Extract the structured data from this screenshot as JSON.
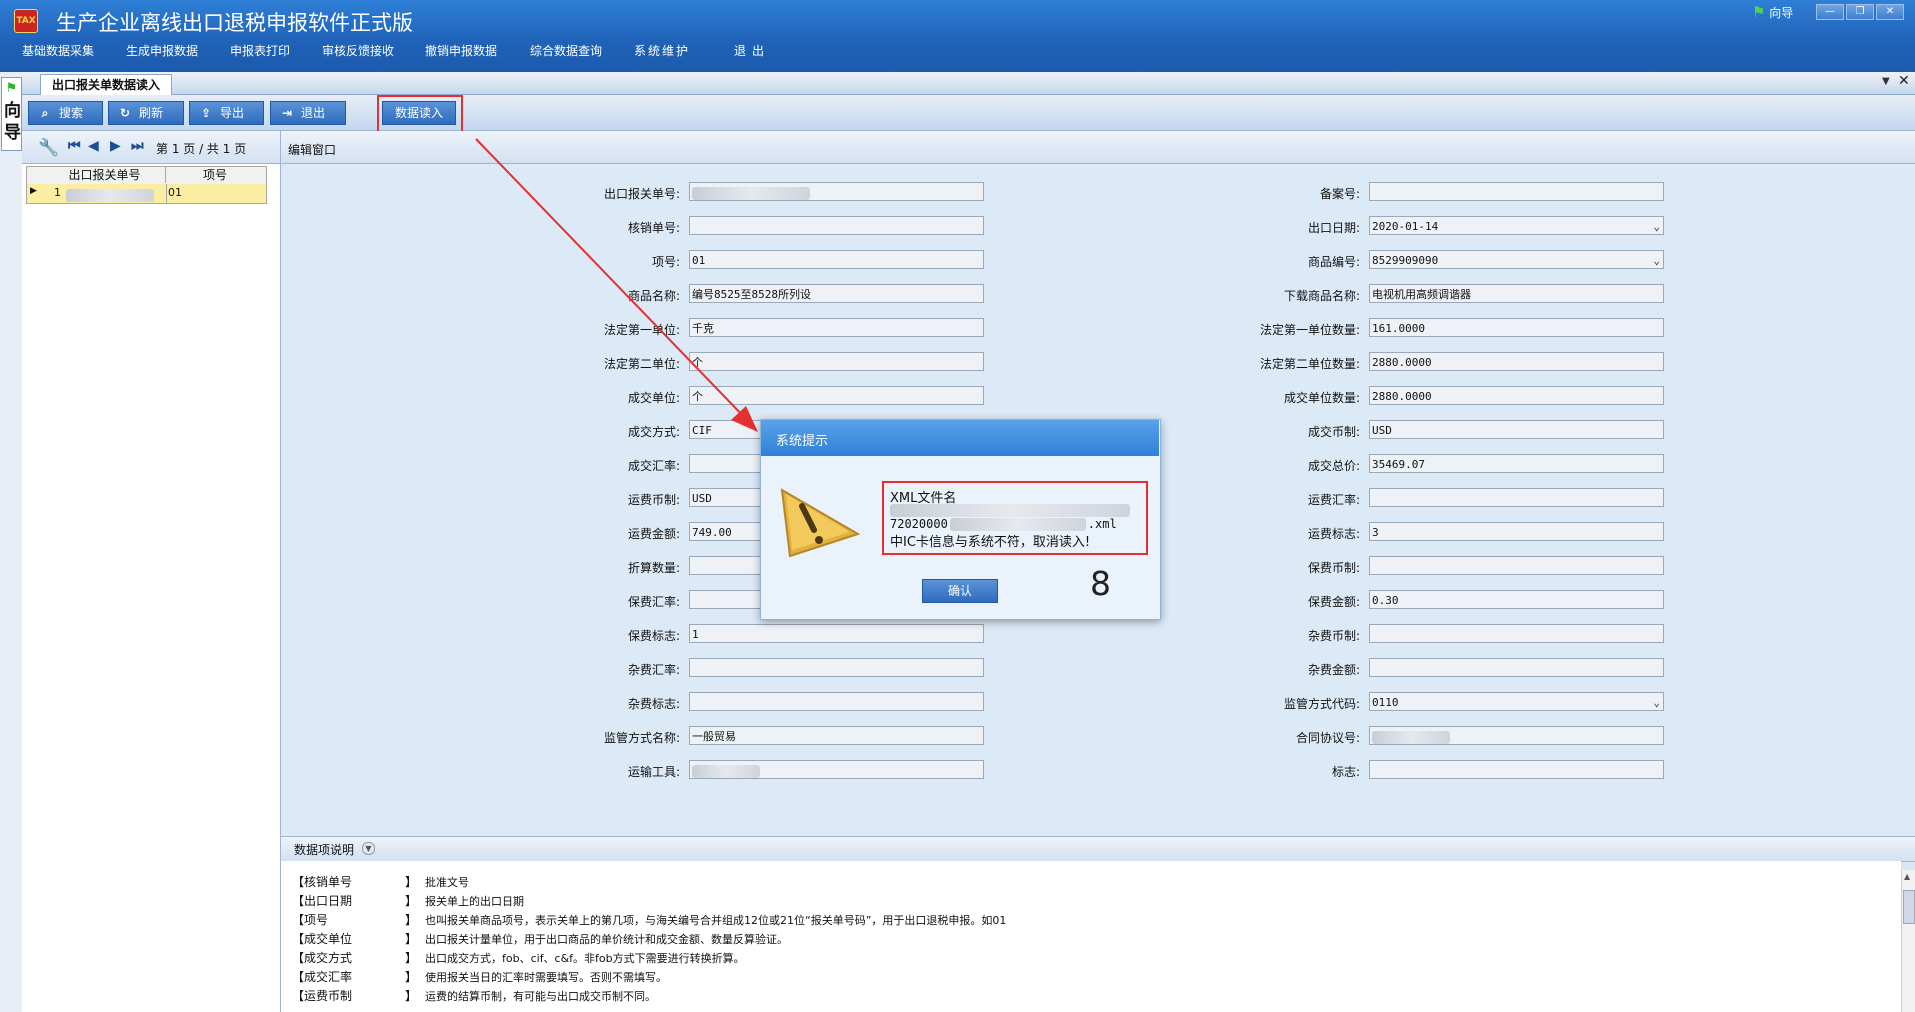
{
  "app": {
    "title": "生产企业离线出口退税申报软件正式版",
    "guide_label": "向导",
    "menu": [
      "基础数据采集",
      "生成申报数据",
      "申报表打印",
      "审核反馈接收",
      "撤销申报数据",
      "综合数据查询",
      "系统维护",
      "退出"
    ]
  },
  "sidebar": {
    "guide_vertical": "向导"
  },
  "tab": {
    "label": "出口报关单数据读入"
  },
  "toolbar": {
    "search": "搜索",
    "refresh": "刷新",
    "export": "导出",
    "exit": "退出",
    "import": "数据读入"
  },
  "pager": {
    "text": "第 1 页 / 共 1 页"
  },
  "grid": {
    "headers": [
      "出口报关单号",
      "项号"
    ],
    "rows": [
      {
        "index": "1",
        "item_no": "01"
      }
    ]
  },
  "edit": {
    "title": "编辑窗口"
  },
  "form_left": [
    {
      "label": "出口报关单号:",
      "value": ""
    },
    {
      "label": "核销单号:",
      "value": ""
    },
    {
      "label": "项号:",
      "value": "01"
    },
    {
      "label": "商品名称:",
      "value": "编号8525至8528所列设"
    },
    {
      "label": "法定第一单位:",
      "value": "千克"
    },
    {
      "label": "法定第二单位:",
      "value": "个"
    },
    {
      "label": "成交单位:",
      "value": "个"
    },
    {
      "label": "成交方式:",
      "value": "CIF"
    },
    {
      "label": "成交汇率:",
      "value": ""
    },
    {
      "label": "运费币制:",
      "value": "USD"
    },
    {
      "label": "运费金额:",
      "value": "749.00"
    },
    {
      "label": "折算数量:",
      "value": ""
    },
    {
      "label": "保费汇率:",
      "value": ""
    },
    {
      "label": "保费标志:",
      "value": "1"
    },
    {
      "label": "杂费汇率:",
      "value": ""
    },
    {
      "label": "杂费标志:",
      "value": ""
    },
    {
      "label": "监管方式名称:",
      "value": "一般贸易"
    },
    {
      "label": "运输工具:",
      "value": ""
    }
  ],
  "form_right": [
    {
      "label": "备案号:",
      "value": ""
    },
    {
      "label": "出口日期:",
      "value": "2020-01-14"
    },
    {
      "label": "商品编号:",
      "value": "8529909090"
    },
    {
      "label": "下载商品名称:",
      "value": "电视机用高频调谐器"
    },
    {
      "label": "法定第一单位数量:",
      "value": "161.0000"
    },
    {
      "label": "法定第二单位数量:",
      "value": "2880.0000"
    },
    {
      "label": "成交单位数量:",
      "value": "2880.0000"
    },
    {
      "label": "成交币制:",
      "value": "USD"
    },
    {
      "label": "成交总价:",
      "value": "35469.07"
    },
    {
      "label": "运费汇率:",
      "value": ""
    },
    {
      "label": "运费标志:",
      "value": "3"
    },
    {
      "label": "保费币制:",
      "value": ""
    },
    {
      "label": "保费金额:",
      "value": "0.30"
    },
    {
      "label": "杂费币制:",
      "value": ""
    },
    {
      "label": "杂费金额:",
      "value": ""
    },
    {
      "label": "监管方式代码:",
      "value": "0110"
    },
    {
      "label": "合同协议号:",
      "value": ""
    },
    {
      "label": "标志:",
      "value": ""
    }
  ],
  "description": {
    "title": "数据项说明",
    "items": [
      {
        "key": "【核销单号",
        "val": "批准文号"
      },
      {
        "key": "【出口日期",
        "val": "报关单上的出口日期"
      },
      {
        "key": "【项号",
        "val": "也叫报关单商品项号，表示关单上的第几项，与海关编号合并组成12位或21位“报关单号码”，用于出口退税申报。如01"
      },
      {
        "key": "【成交单位",
        "val": "出口报关计量单位，用于出口商品的单价统计和成交金额、数量反算验证。"
      },
      {
        "key": "【成交方式",
        "val": "出口成交方式，fob、cif、c&f。非fob方式下需要进行转换折算。"
      },
      {
        "key": "【成交汇率",
        "val": "使用报关当日的汇率时需要填写。否则不需填写。"
      },
      {
        "key": "【运费币制",
        "val": "运费的结算币制，有可能与出口成交币制不同。"
      }
    ],
    "close_bracket": "】"
  },
  "modal": {
    "title": "系统提示",
    "line1": "XML文件名",
    "line2": "72020000",
    "line2_end": ".xml",
    "line3": "中IC卡信息与系统不符，取消读入!",
    "ok": "确认",
    "countdown": "8"
  },
  "colors": {
    "accent": "#2f7fd6",
    "highlight": "#e53030",
    "selected_row": "#fbeea2"
  }
}
